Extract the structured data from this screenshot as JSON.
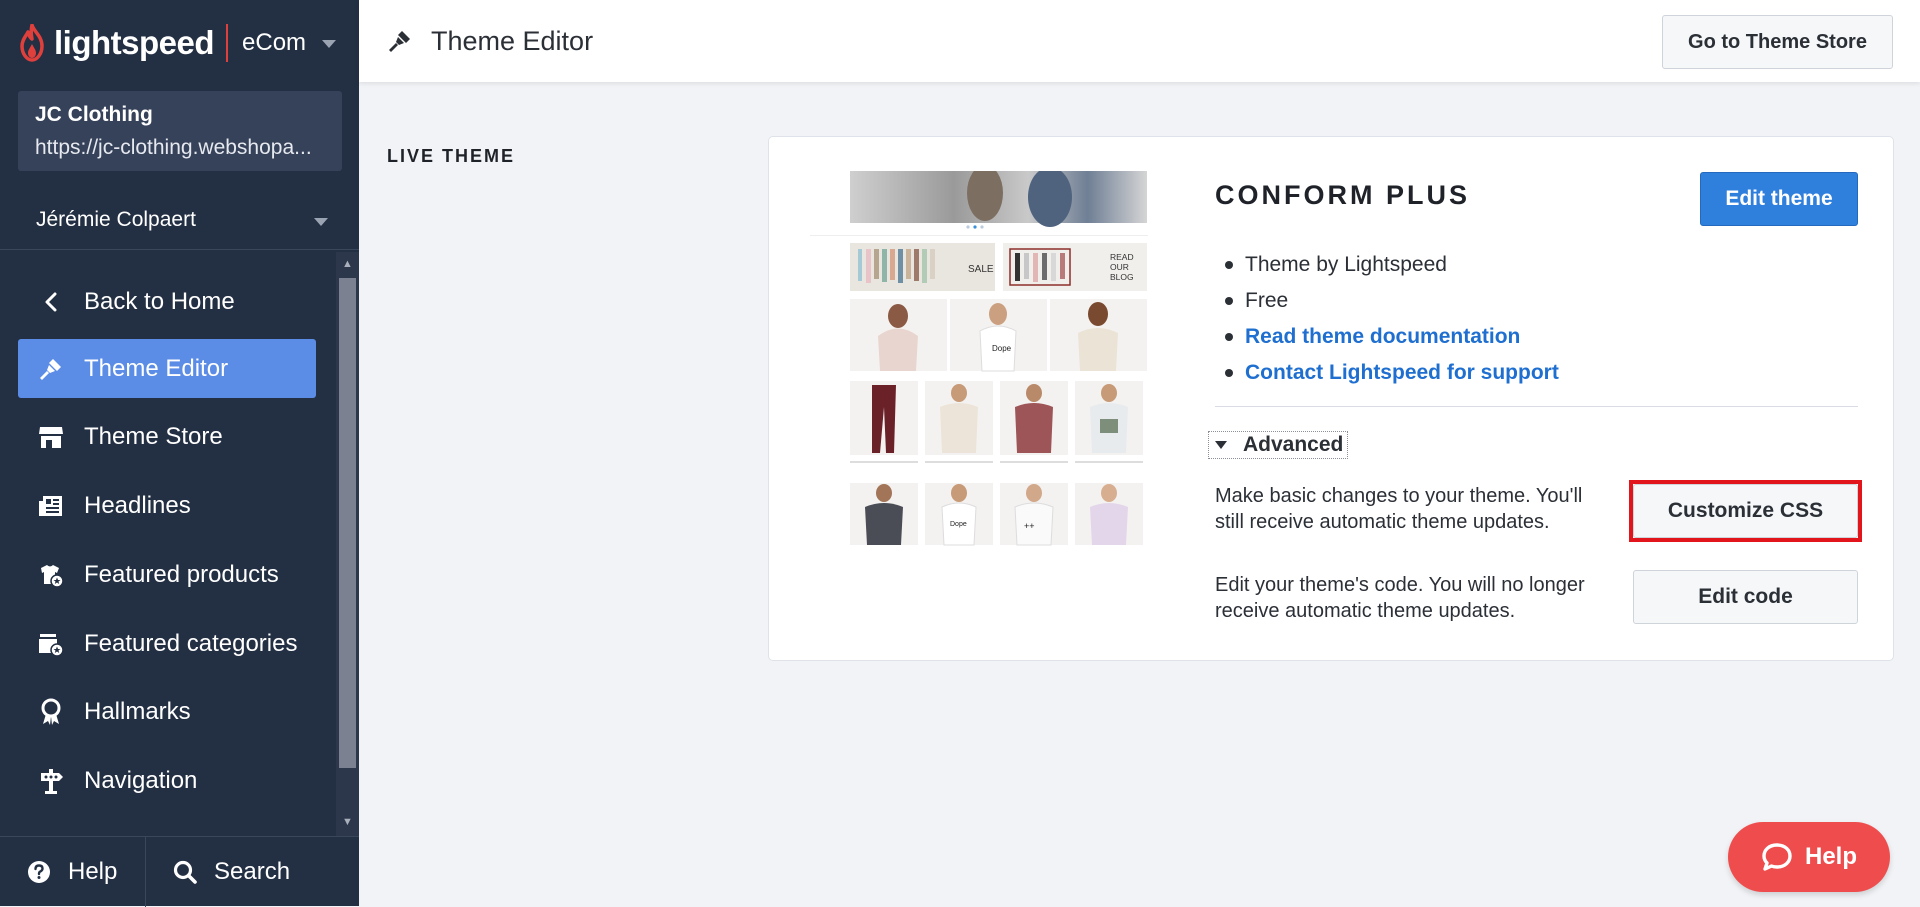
{
  "brand": {
    "name": "lightspeed",
    "product": "eCom"
  },
  "shop": {
    "name": "JC Clothing",
    "url": "https://jc-clothing.webshopa..."
  },
  "user": {
    "name": "Jérémie Colpaert"
  },
  "nav": {
    "items": [
      {
        "label": "Back to Home",
        "icon": "chevron-left-icon",
        "active": false
      },
      {
        "label": "Theme Editor",
        "icon": "paint-brush-icon",
        "active": true
      },
      {
        "label": "Theme Store",
        "icon": "store-icon",
        "active": false
      },
      {
        "label": "Headlines",
        "icon": "newspaper-icon",
        "active": false
      },
      {
        "label": "Featured products",
        "icon": "featured-products-icon",
        "active": false
      },
      {
        "label": "Featured categories",
        "icon": "featured-categories-icon",
        "active": false
      },
      {
        "label": "Hallmarks",
        "icon": "award-icon",
        "active": false
      },
      {
        "label": "Navigation",
        "icon": "signpost-icon",
        "active": false
      }
    ]
  },
  "bottom": {
    "help_label": "Help",
    "search_label": "Search"
  },
  "header": {
    "title": "Theme Editor",
    "store_button": "Go to Theme Store"
  },
  "section": {
    "label": "LIVE THEME"
  },
  "theme": {
    "name": "CONFORM PLUS",
    "edit_button": "Edit theme",
    "info": [
      {
        "text": "Theme by Lightspeed",
        "link": false
      },
      {
        "text": "Free",
        "link": false
      },
      {
        "text": "Read theme documentation",
        "link": true
      },
      {
        "text": "Contact Lightspeed for support",
        "link": true
      }
    ],
    "preview": {
      "sale_label": "SALE",
      "blog_label": "READ OUR BLOG"
    },
    "advanced": {
      "label": "Advanced",
      "css_text": "Make basic changes to your theme. You'll still receive automatic theme updates.",
      "css_button": "Customize CSS",
      "code_text": "Edit your theme's code. You will no longer receive automatic theme updates.",
      "code_button": "Edit code"
    }
  },
  "help_bubble": {
    "label": "Help"
  },
  "colors": {
    "sidebar": "#232f43",
    "accent": "#5b8ce6",
    "primary_button": "#2f7fdc",
    "link": "#1f6fd0",
    "help": "#ef4d4d",
    "highlight": "#e2141c"
  }
}
